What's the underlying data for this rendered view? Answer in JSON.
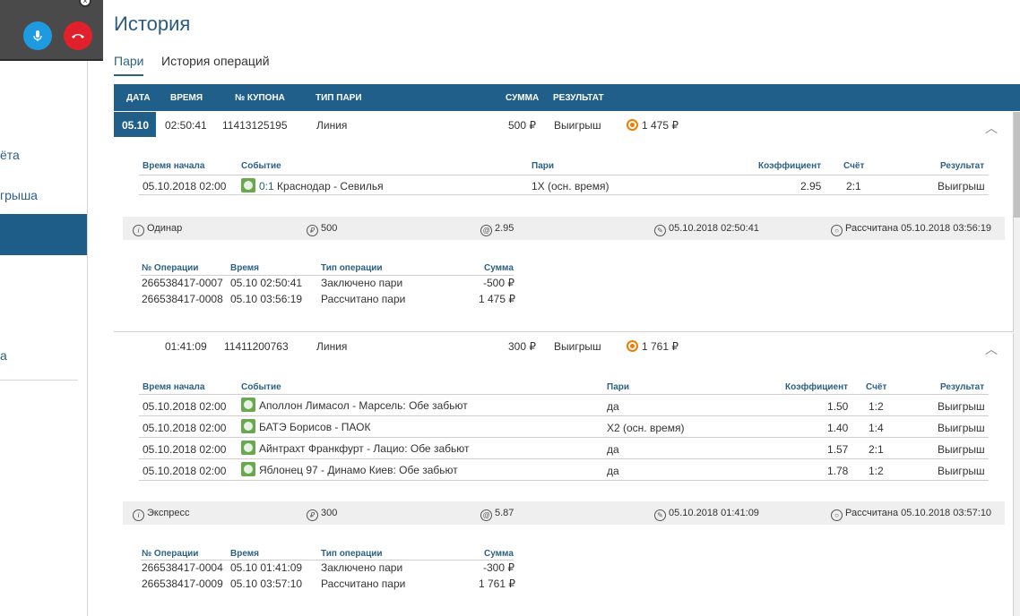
{
  "sidebar": {
    "items": [
      {
        "label": "ёта"
      },
      {
        "label": "грыша"
      },
      {
        "label": ""
      },
      {
        "label": "а"
      }
    ]
  },
  "page": {
    "title": "История"
  },
  "tabs": [
    {
      "label": "Пари",
      "active": true
    },
    {
      "label": "История операций",
      "active": false
    }
  ],
  "columns": {
    "date": "ДАТА",
    "time": "ВРЕМЯ",
    "coupon": "№ КУПОНА",
    "bet_type": "ТИП ПАРИ",
    "sum": "СУММА",
    "result": "РЕЗУЛЬТАТ"
  },
  "bets": [
    {
      "date": "05.10",
      "time": "02:50:41",
      "coupon": "11413125195",
      "type": "Линия",
      "sum": "500 ₽",
      "result": "Выигрыш",
      "payout": "1 475 ₽",
      "events_head": {
        "start": "Время начала",
        "event": "Событие",
        "bet": "Пари",
        "coef": "Коэффициент",
        "score": "Счёт",
        "result": "Результат"
      },
      "events": [
        {
          "start": "05.10.2018 02:00",
          "score_link": "0:1",
          "event": "Краснодар - Севилья",
          "bet": "1X (осн. время)",
          "coef": "2.95",
          "score": "2:1",
          "result": "Выигрыш"
        }
      ],
      "summary": {
        "kind": "Одинар",
        "stake": "500",
        "coef": "2.95",
        "placed": "05.10.2018 02:50:41",
        "settled": "Рассчитана 05.10.2018 03:56:19"
      },
      "ops_head": {
        "id": "№ Операции",
        "time": "Время",
        "type": "Тип операции",
        "sum": "Сумма"
      },
      "ops": [
        {
          "id": "266538417-0007",
          "time": "05.10 02:50:41",
          "type": "Заключено пари",
          "sum": "-500 ₽"
        },
        {
          "id": "266538417-0008",
          "time": "05.10 03:56:19",
          "type": "Рассчитано пари",
          "sum": "1 475 ₽"
        }
      ]
    },
    {
      "date": "",
      "time": "01:41:09",
      "coupon": "11411200763",
      "type": "Линия",
      "sum": "300 ₽",
      "result": "Выигрыш",
      "payout": "1 761 ₽",
      "events_head": {
        "start": "Время начала",
        "event": "Событие",
        "bet": "Пари",
        "coef": "Коэффициент",
        "score": "Счёт",
        "result": "Результат"
      },
      "events": [
        {
          "start": "05.10.2018 02:00",
          "event": "Аполлон Лимасол - Марсель: Обе забьют",
          "bet": "да",
          "coef": "1.50",
          "score": "1:2",
          "result": "Выигрыш"
        },
        {
          "start": "05.10.2018 02:00",
          "event": "БАТЭ Борисов - ПАОК",
          "bet": "Х2 (осн. время)",
          "coef": "1.40",
          "score": "1:4",
          "result": "Выигрыш"
        },
        {
          "start": "05.10.2018 02:00",
          "event": "Айнтрахт Франкфурт - Лацио: Обе забьют",
          "bet": "да",
          "coef": "1.57",
          "score": "2:1",
          "result": "Выигрыш"
        },
        {
          "start": "05.10.2018 02:00",
          "event": "Яблонец 97 - Динамо Киев: Обе забьют",
          "bet": "да",
          "coef": "1.78",
          "score": "1:2",
          "result": "Выигрыш"
        }
      ],
      "summary": {
        "kind": "Экспресс",
        "stake": "300",
        "coef": "5.87",
        "placed": "05.10.2018 01:41:09",
        "settled": "Рассчитана 05.10.2018 03:57:10"
      },
      "ops_head": {
        "id": "№ Операции",
        "time": "Время",
        "type": "Тип операции",
        "sum": "Сумма"
      },
      "ops": [
        {
          "id": "266538417-0004",
          "time": "05.10 01:41:09",
          "type": "Заключено пари",
          "sum": "-300 ₽"
        },
        {
          "id": "266538417-0009",
          "time": "05.10 03:57:10",
          "type": "Рассчитано пари",
          "sum": "1 761 ₽"
        }
      ]
    }
  ],
  "colors": {
    "accent": "#1f5f8a",
    "win": "#f07d00",
    "sport": "#6aa84f"
  }
}
